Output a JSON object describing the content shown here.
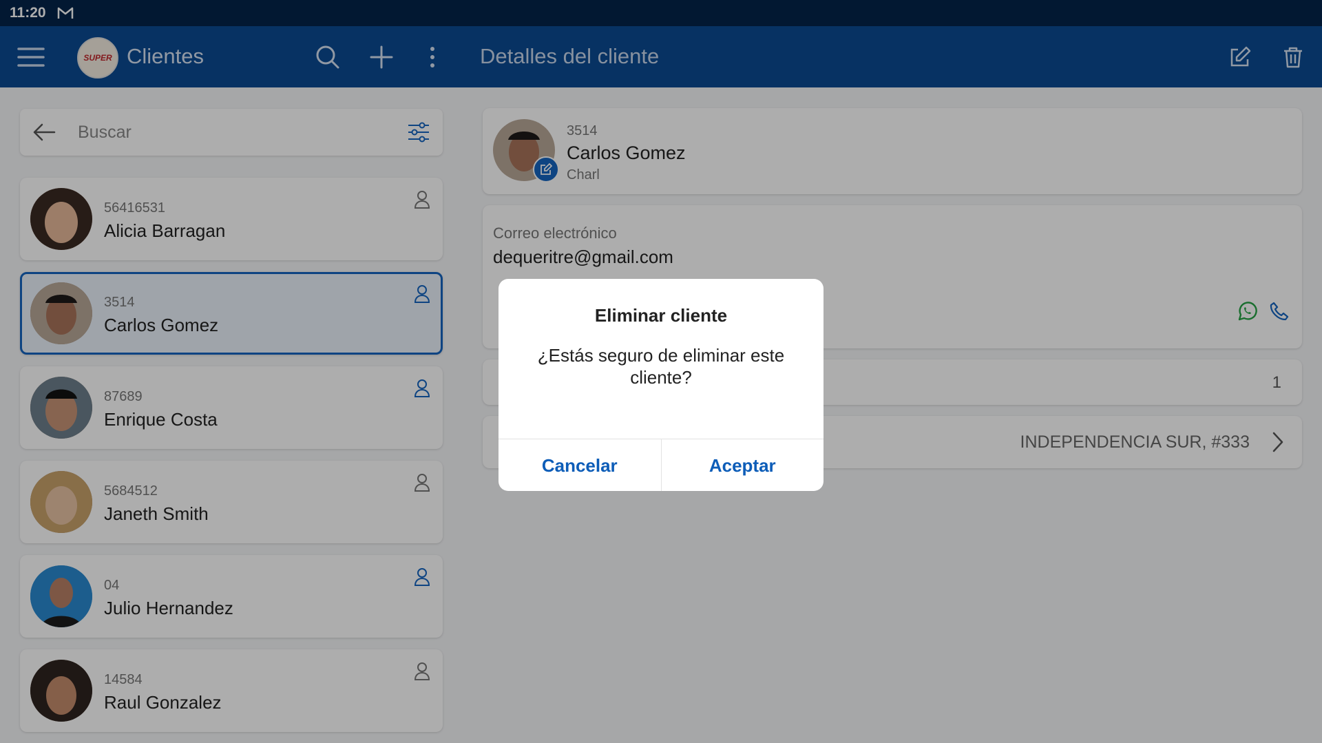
{
  "status_bar": {
    "time": "11:20",
    "mail_icon": "gmail-icon"
  },
  "app_bar": {
    "left_title": "Clientes",
    "right_title": "Detalles del cliente",
    "logo_text": "SUPER"
  },
  "search": {
    "placeholder": "Buscar"
  },
  "clients": [
    {
      "code": "56416531",
      "name": "Alicia Barragan"
    },
    {
      "code": "3514",
      "name": "Carlos Gomez"
    },
    {
      "code": "87689",
      "name": "Enrique Costa"
    },
    {
      "code": "5684512",
      "name": "Janeth Smith"
    },
    {
      "code": "04",
      "name": "Julio Hernandez"
    },
    {
      "code": "14584",
      "name": "Raul Gonzalez"
    }
  ],
  "detail": {
    "code": "3514",
    "name": "Carlos Gomez",
    "nickname": "Charl",
    "email_label": "Correo electrónico",
    "email_value": "dequeritre@gmail.com",
    "row3_value": "1",
    "address": "INDEPENDENCIA SUR, #333"
  },
  "dialog": {
    "title": "Eliminar cliente",
    "message": "¿Estás seguro de eliminar este cliente?",
    "cancel": "Cancelar",
    "accept": "Aceptar"
  },
  "colors": {
    "status_bar": "#03244a",
    "app_bar": "#0b4a92",
    "accent": "#1565c0",
    "whatsapp": "#25a244"
  }
}
